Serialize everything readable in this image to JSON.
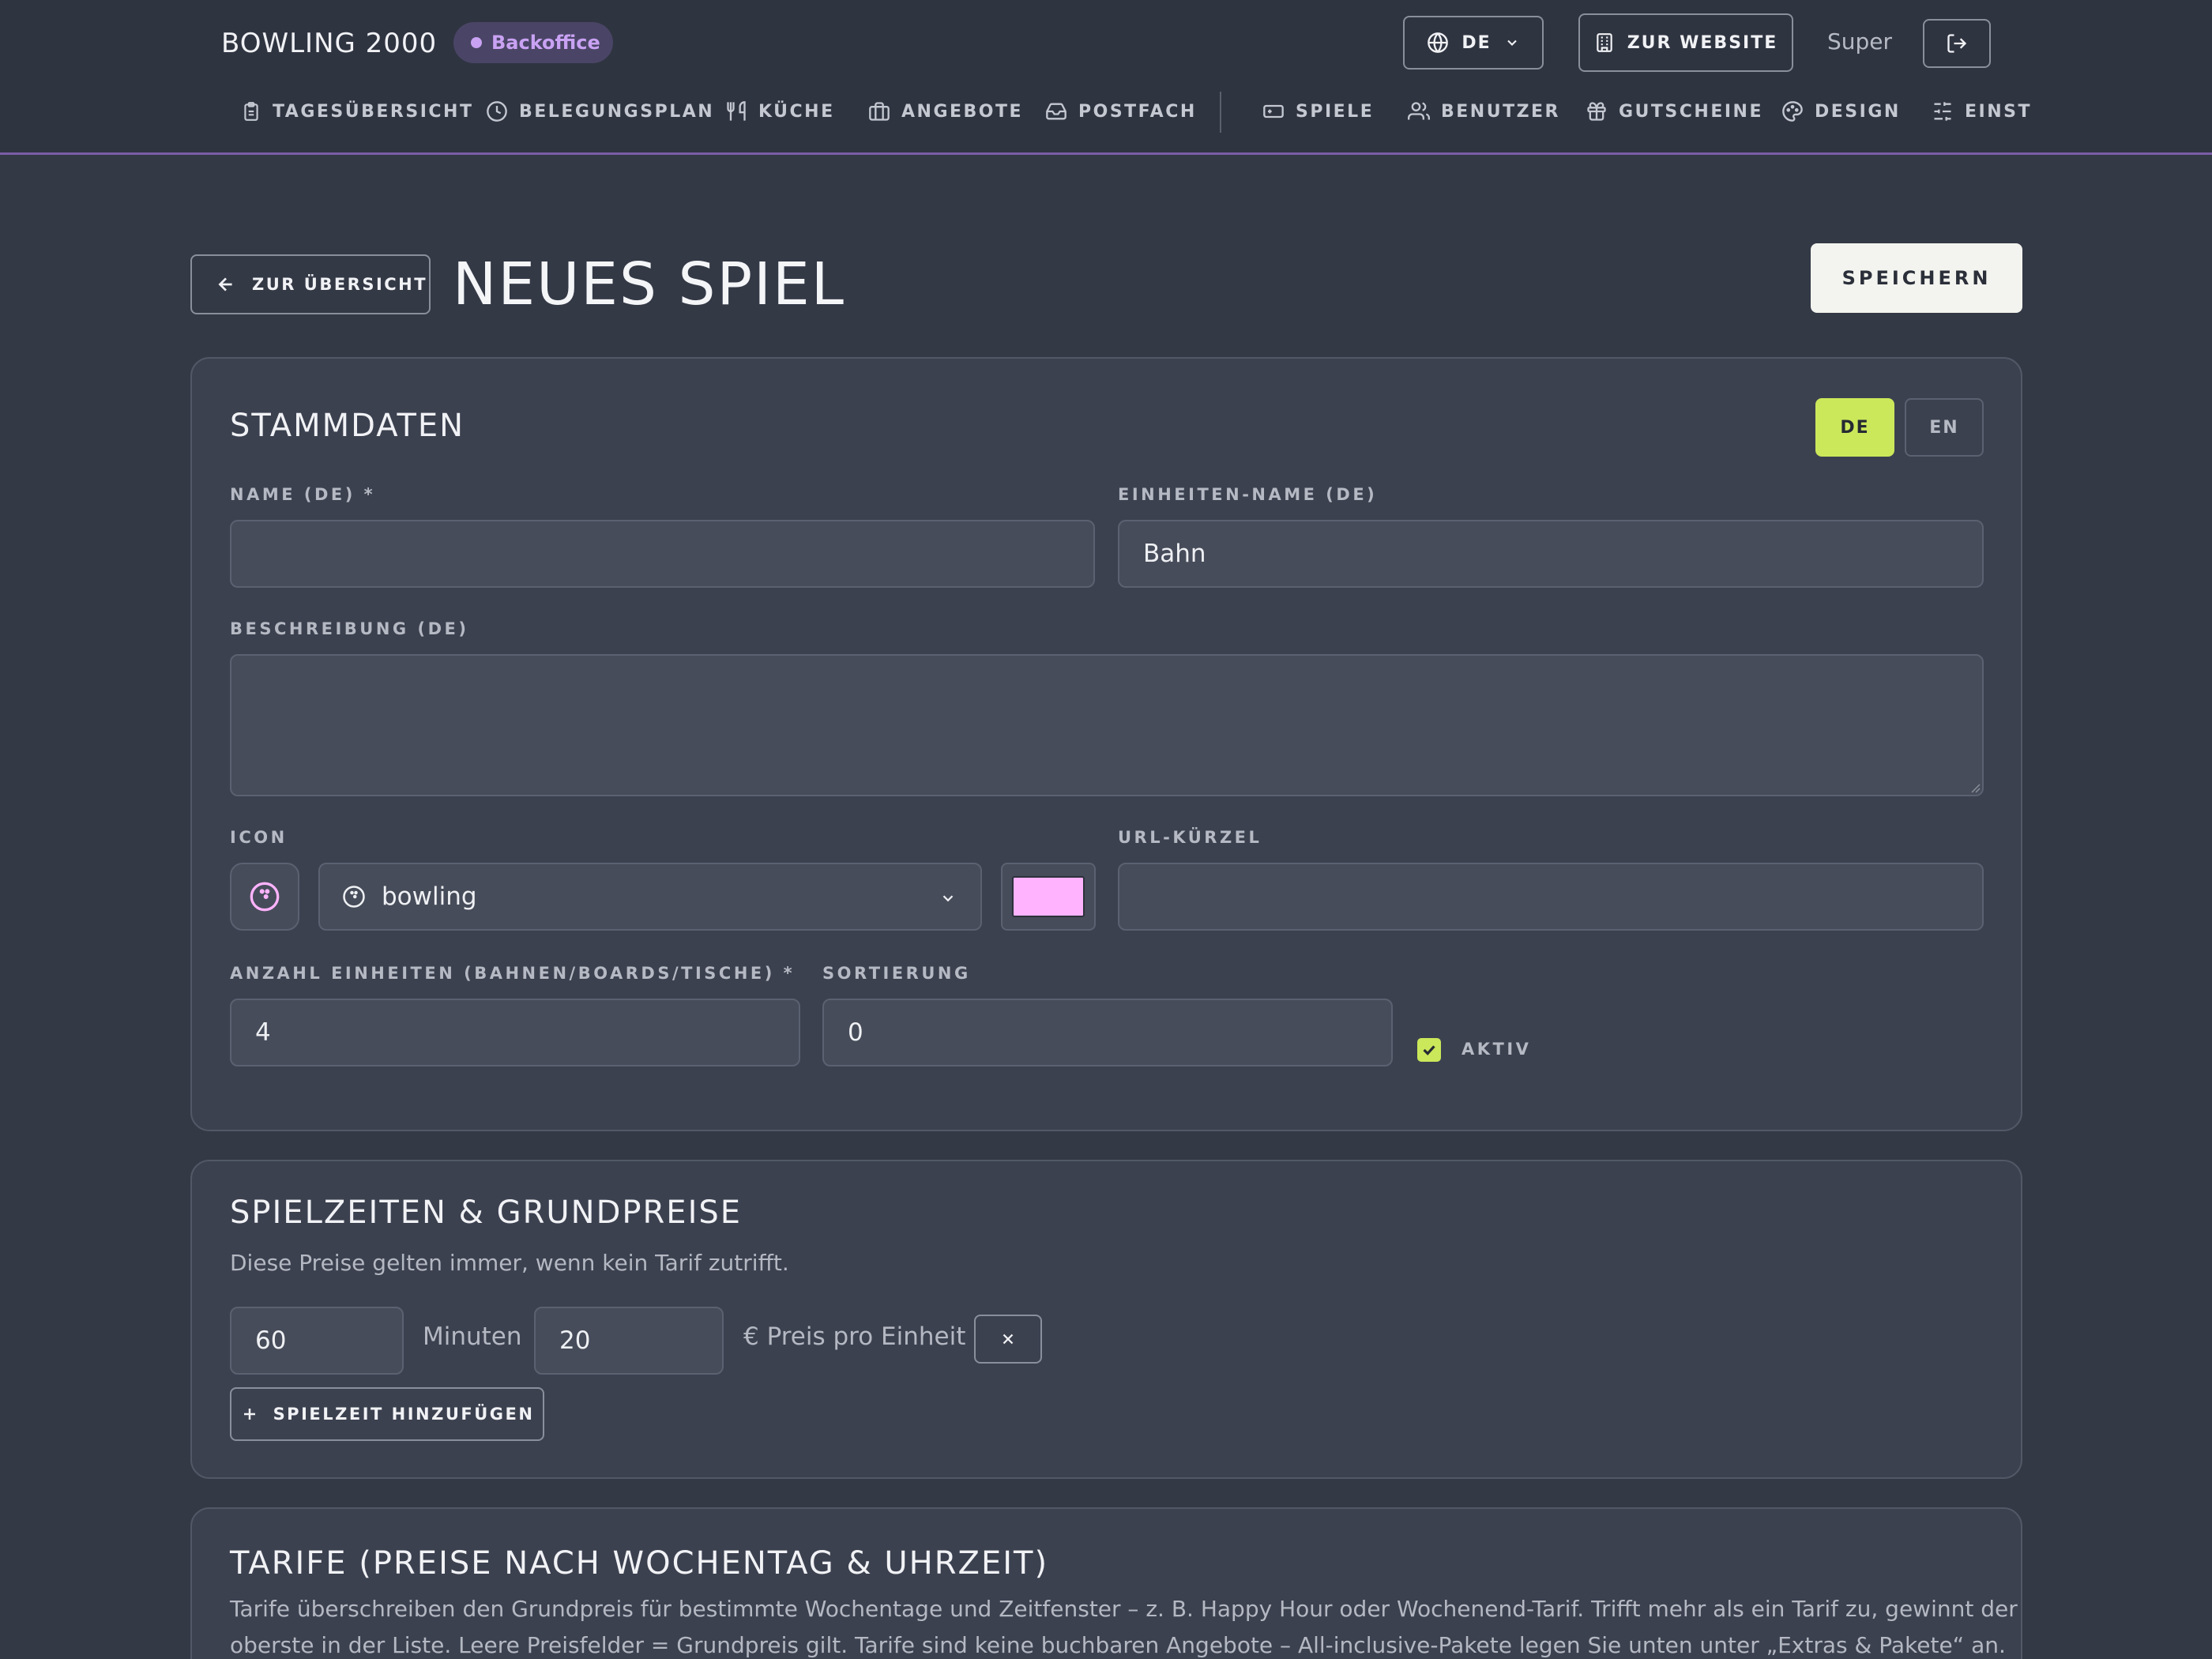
{
  "header": {
    "brand": "BOWLING 2000",
    "badge": "Backoffice",
    "language": "DE",
    "website_button": "ZUR WEBSITE",
    "user_name": "Super",
    "nav": [
      {
        "label": "TAGESÜBERSICHT",
        "icon": "clipboard-icon"
      },
      {
        "label": "BELEGUNGSPLAN",
        "icon": "clock-icon"
      },
      {
        "label": "KÜCHE",
        "icon": "fork-knife-icon"
      },
      {
        "label": "ANGEBOTE",
        "icon": "package-icon"
      },
      {
        "label": "POSTFACH",
        "icon": "inbox-icon"
      },
      {
        "label": "SPIELE",
        "icon": "gamepad-icon"
      },
      {
        "label": "BENUTZER",
        "icon": "users-icon"
      },
      {
        "label": "GUTSCHEINE",
        "icon": "gift-icon"
      },
      {
        "label": "DESIGN",
        "icon": "palette-icon"
      },
      {
        "label": "EINST",
        "icon": "sliders-icon"
      }
    ]
  },
  "page": {
    "back_button": "ZUR ÜBERSICHT",
    "title": "NEUES SPIEL",
    "save_button": "SPEICHERN"
  },
  "stammdaten": {
    "title": "STAMMDATEN",
    "lang_options": [
      "DE",
      "EN"
    ],
    "active_lang": "DE",
    "name_label": "NAME (DE) *",
    "name_value": "",
    "unit_name_label": "EINHEITEN-NAME (DE)",
    "unit_name_value": "Bahn",
    "description_label": "BESCHREIBUNG (DE)",
    "description_value": "",
    "icon_label": "ICON",
    "icon_value": "bowling",
    "icon_color": "#ffb3ff",
    "url_label": "URL-KÜRZEL",
    "url_value": "",
    "units_label": "ANZAHL EINHEITEN (BAHNEN/BOARDS/TISCHE) *",
    "units_value": "4",
    "sort_label": "SORTIERUNG",
    "sort_value": "0",
    "active_label": "AKTIV",
    "active_checked": true
  },
  "spielzeiten": {
    "title": "SPIELZEITEN & GRUNDPREISE",
    "subtitle": "Diese Preise gelten immer, wenn kein Tarif zutrifft.",
    "rows": [
      {
        "minutes": "60",
        "minutes_unit": "Minuten",
        "price": "20",
        "price_unit": "€ Preis pro Einheit"
      }
    ],
    "add_button": "SPIELZEIT HINZUFÜGEN"
  },
  "tarife": {
    "title": "TARIFE (PREISE NACH WOCHENTAG & UHRZEIT)",
    "text_line1": "Tarife überschreiben den Grundpreis für bestimmte Wochentage und Zeitfenster – z. B. Happy Hour oder Wochenend-Tarif. Trifft mehr als ein Tarif zu, gewinnt der",
    "text_line2": "oberste in der Liste. Leere Preisfelder = Grundpreis gilt. Tarife sind keine buchbaren Angebote – All-inclusive-Pakete legen Sie unten unter „Extras & Pakete“ an."
  },
  "colors": {
    "accent_lime": "#cbe85a",
    "badge_purple": "#c9a2f3",
    "header_line": "#7b5ea7"
  }
}
